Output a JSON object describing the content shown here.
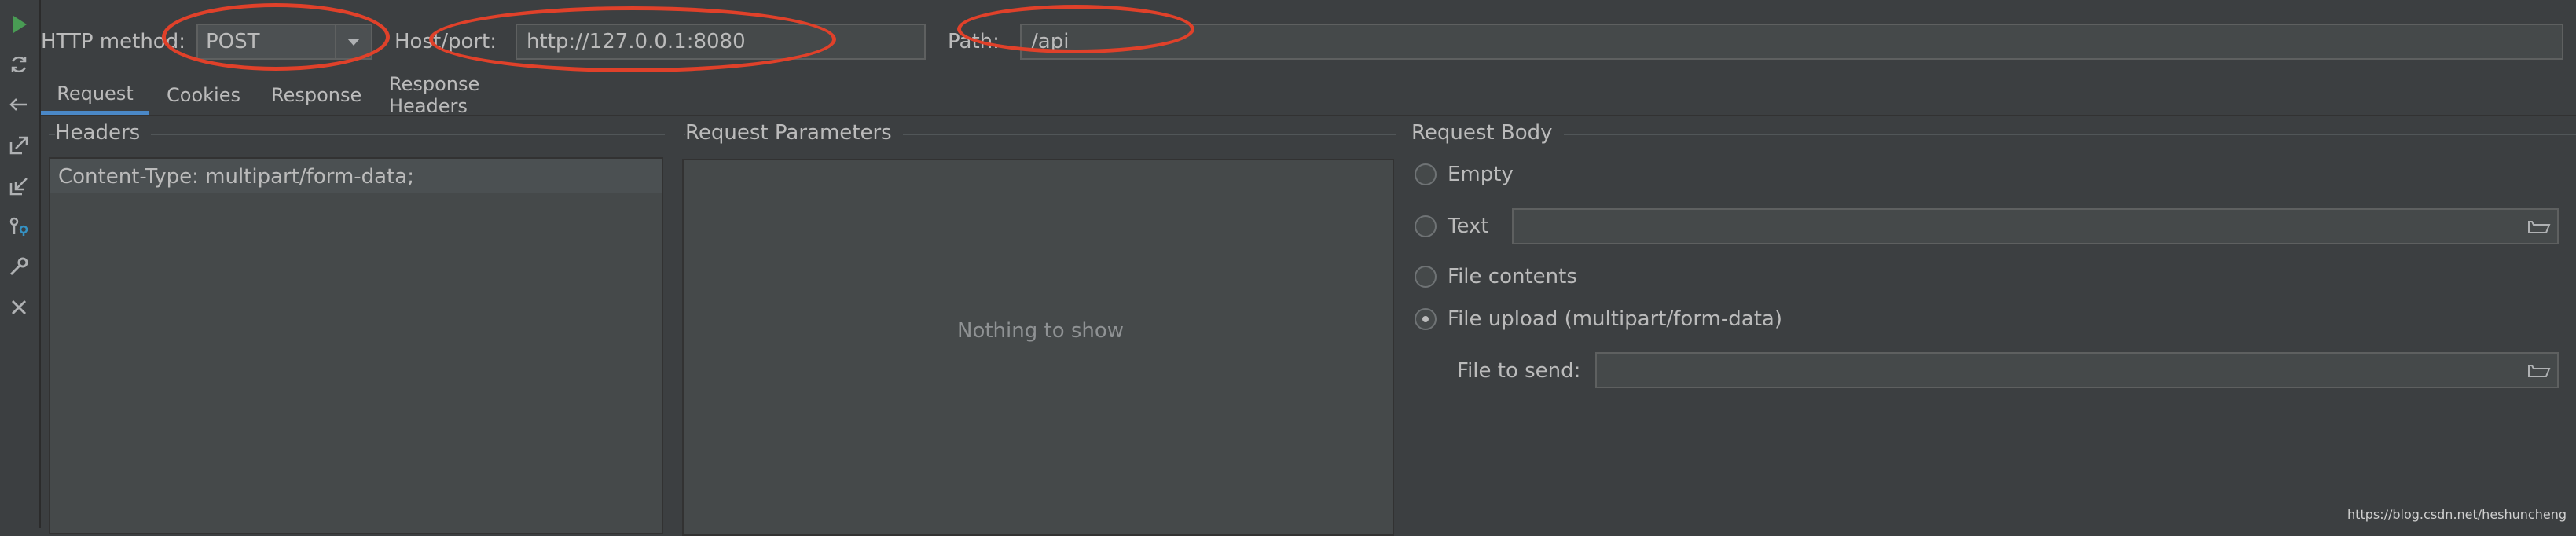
{
  "toolbar": {
    "icons": [
      "run-icon",
      "refresh-icon",
      "back-icon",
      "export-icon",
      "import-icon",
      "key-icon",
      "wrench-icon",
      "close-icon"
    ]
  },
  "request_line": {
    "method_label": "HTTP method:",
    "method_value": "POST",
    "host_label": "Host/port:",
    "host_value": "http://127.0.0.1:8080",
    "path_label": "Path:",
    "path_value": "/api"
  },
  "tabs": [
    {
      "label": "Request",
      "active": true
    },
    {
      "label": "Cookies",
      "active": false
    },
    {
      "label": "Response",
      "active": false
    },
    {
      "label": "Response Headers",
      "active": false
    }
  ],
  "headers": {
    "title": "Headers",
    "rows": [
      "Content-Type: multipart/form-data;"
    ]
  },
  "params": {
    "title": "Request Parameters",
    "empty_text": "Nothing to show"
  },
  "body": {
    "title": "Request Body",
    "options": {
      "empty": "Empty",
      "text": "Text",
      "file_contents": "File contents",
      "file_upload": "File upload (multipart/form-data)"
    },
    "selected": "file_upload",
    "file_to_send_label": "File to send:"
  },
  "colors": {
    "background": "#3c3f41",
    "accent": "#4a88c7",
    "run": "#499c54",
    "annotation": "#e0412a"
  },
  "watermark": "https://blog.csdn.net/heshuncheng"
}
